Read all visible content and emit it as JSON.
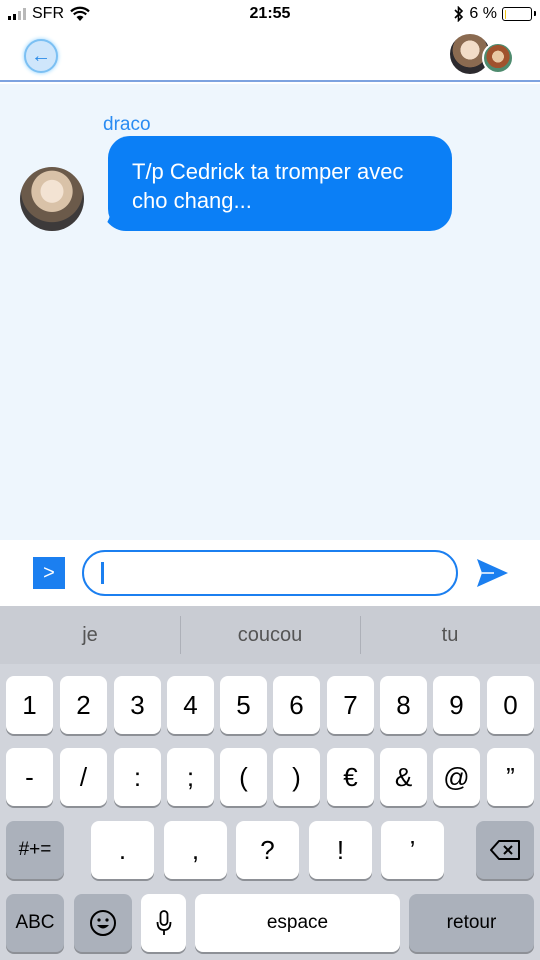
{
  "status_bar": {
    "carrier": "SFR",
    "time": "21:55",
    "battery_percent": "6 %",
    "battery_level": 0.06
  },
  "header": {
    "back_icon": "arrow-left-icon",
    "group_avatar_icons": [
      "avatar-draco",
      "avatar-second-contact"
    ]
  },
  "chat": {
    "messages": [
      {
        "sender": "draco",
        "text_line1": "T/p Cedrick ta tromper avec",
        "text_line2": "cho chang..."
      }
    ]
  },
  "input_bar": {
    "expand_label": ">",
    "message_value": "",
    "send_icon": "paper-plane-icon"
  },
  "keyboard": {
    "suggestions": [
      "je",
      "coucou",
      "tu"
    ],
    "row1": [
      "1",
      "2",
      "3",
      "4",
      "5",
      "6",
      "7",
      "8",
      "9",
      "0"
    ],
    "row2": [
      "-",
      "/",
      ":",
      ";",
      "(",
      ")",
      "€",
      "&",
      "@",
      "”"
    ],
    "row3_left": "#+=",
    "row3": [
      ".",
      ",",
      "?",
      "!",
      "’"
    ],
    "backspace_icon": "backspace-icon",
    "row4_abc": "ABC",
    "emoji_icon": "emoji-icon",
    "mic_icon": "microphone-icon",
    "space": "espace",
    "return": "retour"
  },
  "colors": {
    "accent": "#0b7ff6",
    "chat_bg": "#eef6fd",
    "header_border": "#7da2df",
    "keyboard_bg": "#d1d4db"
  }
}
